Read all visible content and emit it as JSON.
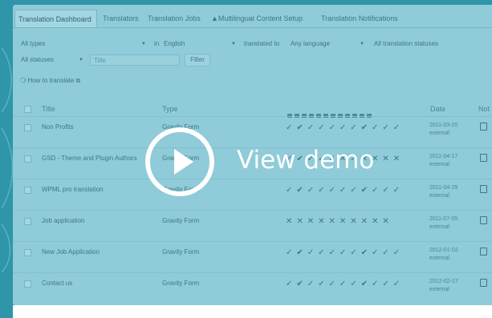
{
  "tabs": [
    {
      "label": "Translation Dashboard",
      "active": true
    },
    {
      "label": "Translators"
    },
    {
      "label": "Translation Jobs"
    },
    {
      "label": "▲Multilingual Content Setup"
    },
    {
      "label": "Translation Notifications"
    }
  ],
  "filters": {
    "type_value": "All types",
    "in_label": "in",
    "language_value": "English",
    "translated_to_label": "translated to",
    "target_language_value": "Any language",
    "status_value": "All translation statuses",
    "statuses_value": "All statuses",
    "title_placeholder": "Title",
    "filter_button": "Filter"
  },
  "how_to_translate": "How to translate",
  "table": {
    "headers": {
      "title": "Title",
      "type": "Type",
      "date": "Date",
      "note": "Not"
    },
    "rows": [
      {
        "title": "Non Profits",
        "type": "Gravity Form",
        "marks": "✓✔✓✓✓✓✓✔✓✓✓",
        "date": "2011-03-20",
        "sub": "external"
      },
      {
        "title": "GSD - Theme and Plugin Authors",
        "type": "Gravity Form",
        "marks": "✓✔✓✓✓✕✓✕✕✕✕",
        "date": "2011-04-17",
        "sub": "external"
      },
      {
        "title": "WPML pro translation",
        "type": "Gravity Form",
        "marks": "✓✔✓✓✓✓✓✔✓✓✓",
        "date": "2011-04-29",
        "sub": "external"
      },
      {
        "title": "Job application",
        "type": "Gravity Form",
        "marks": "✕✕✕✕✕✕✕✕✕✕",
        "date": "2011-07-05",
        "sub": "external"
      },
      {
        "title": "New Job Application",
        "type": "Gravity Form",
        "marks": "✓✔✓✓✓✓✓✔✓✓✓",
        "date": "2012-01-02",
        "sub": "external"
      },
      {
        "title": "Contact us",
        "type": "Gravity Form",
        "marks": "✓✔✓✓✓✓✓✔✓✓✓",
        "date": "2012-02-17",
        "sub": "external"
      }
    ]
  },
  "overlay": {
    "label": "View demo"
  }
}
